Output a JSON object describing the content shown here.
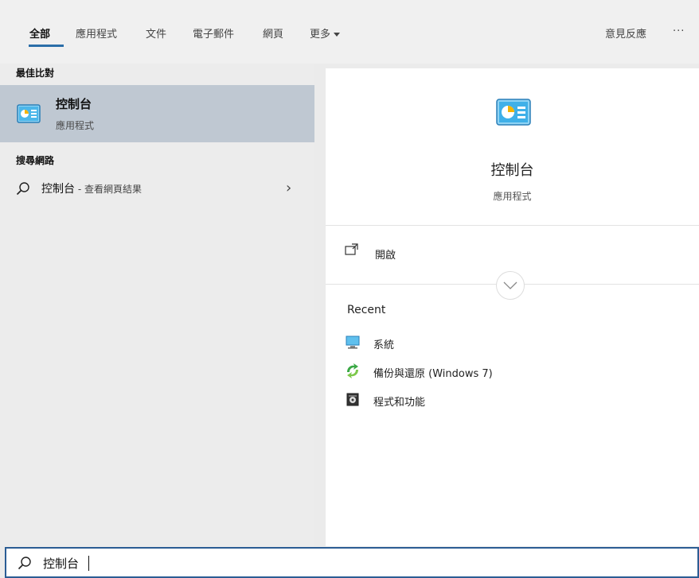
{
  "tabs": [
    {
      "label": "全部",
      "active": true
    },
    {
      "label": "應用程式"
    },
    {
      "label": "文件"
    },
    {
      "label": "電子郵件"
    },
    {
      "label": "網頁"
    },
    {
      "label": "更多"
    }
  ],
  "feedback_label": "意見反應",
  "more_options": "···",
  "best_match": {
    "header": "最佳比對",
    "title": "控制台",
    "subtitle": "應用程式"
  },
  "web_search": {
    "header": "搜尋網路",
    "query": "控制台",
    "suffix": " - 查看網頁結果"
  },
  "detail": {
    "app_name": "控制台",
    "app_type": "應用程式",
    "open_label": "開啟",
    "recent_header": "Recent",
    "recent_items": [
      {
        "label": "系統"
      },
      {
        "label": "備份與還原 (Windows 7)"
      },
      {
        "label": "程式和功能"
      }
    ]
  },
  "search": {
    "value": "控制台"
  },
  "colors": {
    "accent": "#2b6ea8",
    "selected_row": "#bfc8d2",
    "search_border": "#2b5d94"
  }
}
